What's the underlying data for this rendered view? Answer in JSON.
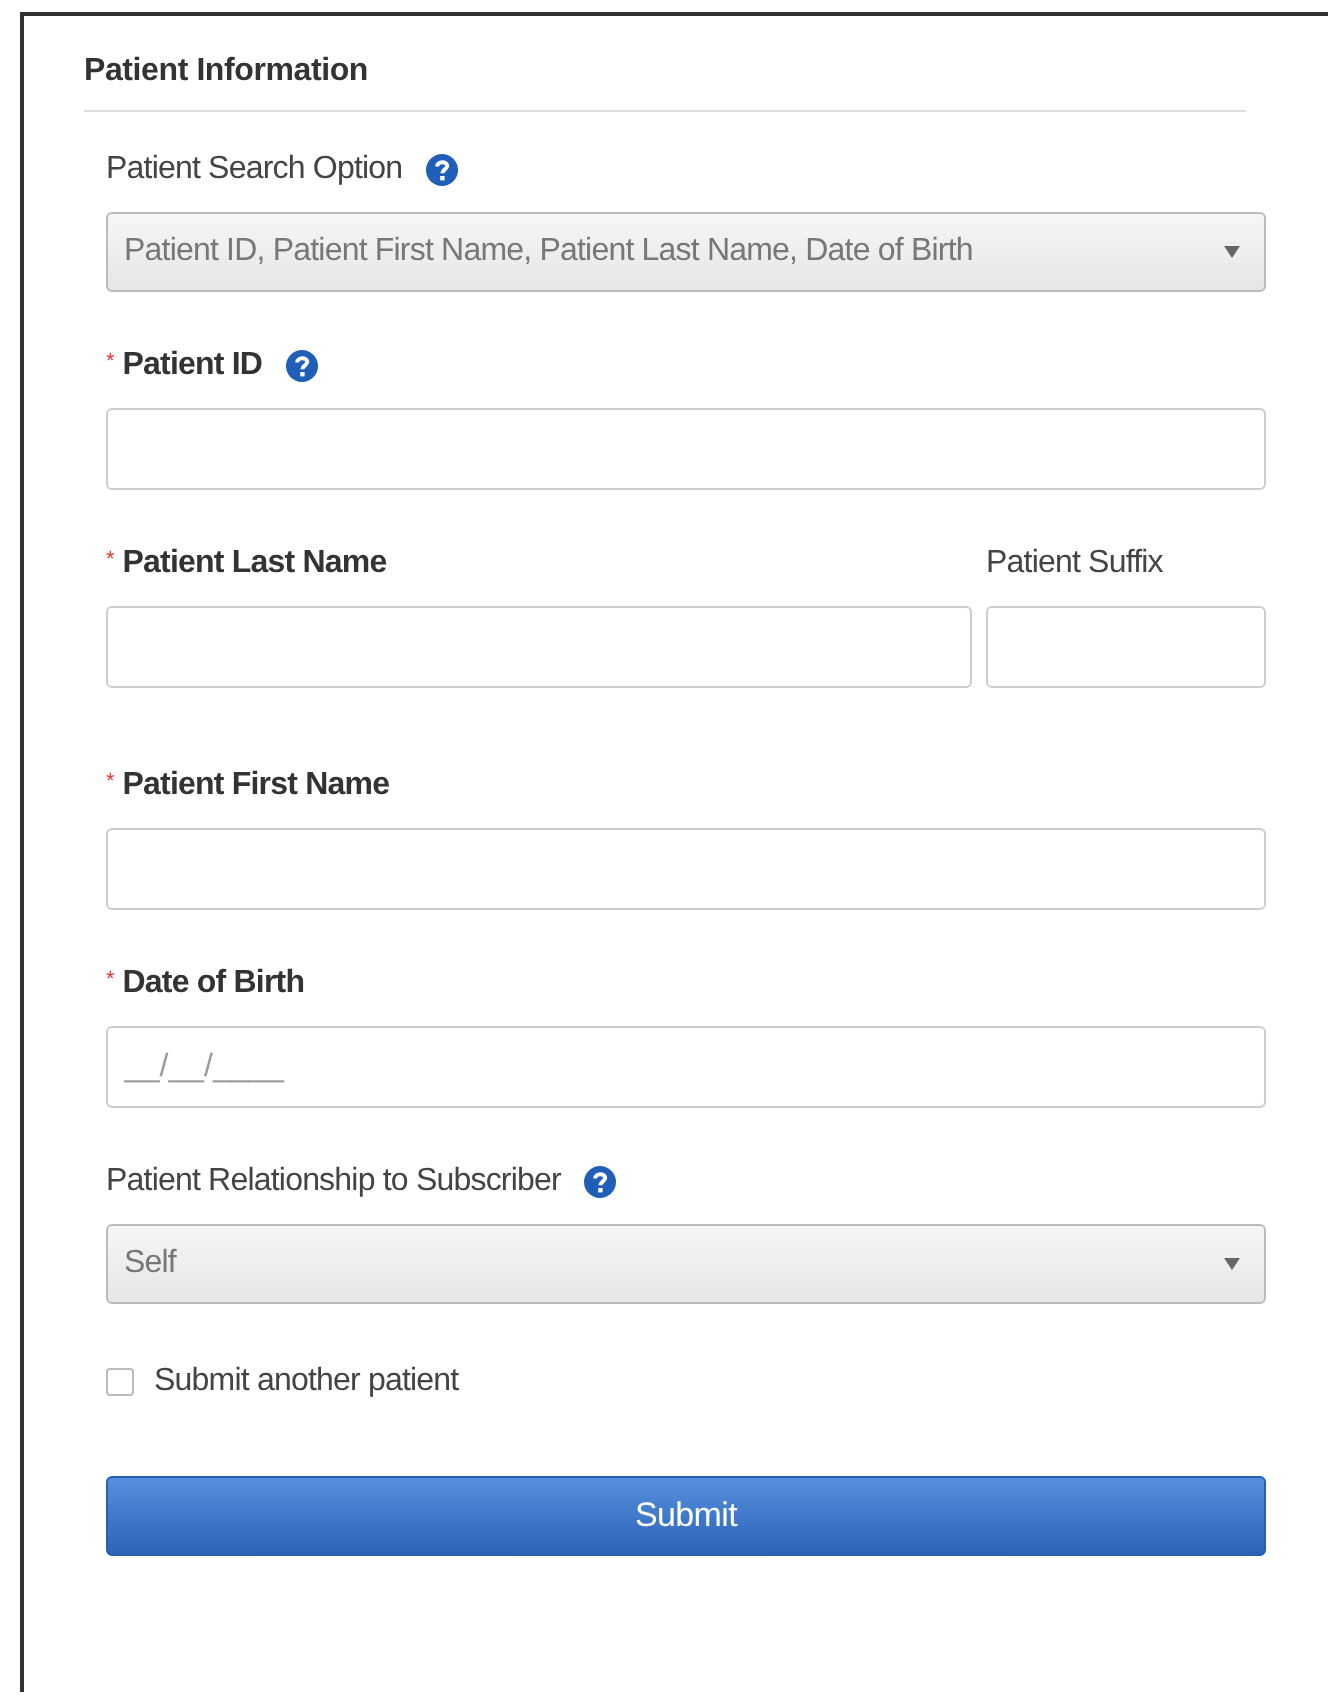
{
  "section": {
    "title": "Patient Information"
  },
  "rows": [
    {
      "fields": [
        {
          "kind": "select",
          "label": "Patient Search Option",
          "required": false,
          "help": true,
          "value": "Patient ID, Patient First Name, Patient Last Name, Date of Birth"
        }
      ]
    },
    {
      "fields": [
        {
          "kind": "text",
          "marker": "*",
          "label": "Patient ID",
          "required": true,
          "help": true
        }
      ]
    },
    {
      "fields": [
        {
          "kind": "text",
          "marker": "*",
          "label": "Patient Last Name",
          "required": true,
          "help": false
        },
        {
          "kind": "text",
          "label": "Patient Suffix",
          "required": false,
          "help": false
        }
      ]
    },
    {
      "fields": [
        {
          "kind": "text",
          "marker": "*",
          "label": "Patient First Name",
          "required": true,
          "help": false
        }
      ]
    },
    {
      "fields": [
        {
          "kind": "text",
          "marker": "*",
          "label": "Date of Birth",
          "required": true,
          "help": false,
          "placeholder": "__/__/____"
        }
      ]
    },
    {
      "fields": [
        {
          "kind": "select",
          "label": "Patient Relationship to Subscriber",
          "required": false,
          "help": true,
          "value": "Self"
        }
      ]
    }
  ],
  "checkbox": {
    "label": "Submit another patient",
    "checked": false
  },
  "button": {
    "label": "Submit"
  }
}
